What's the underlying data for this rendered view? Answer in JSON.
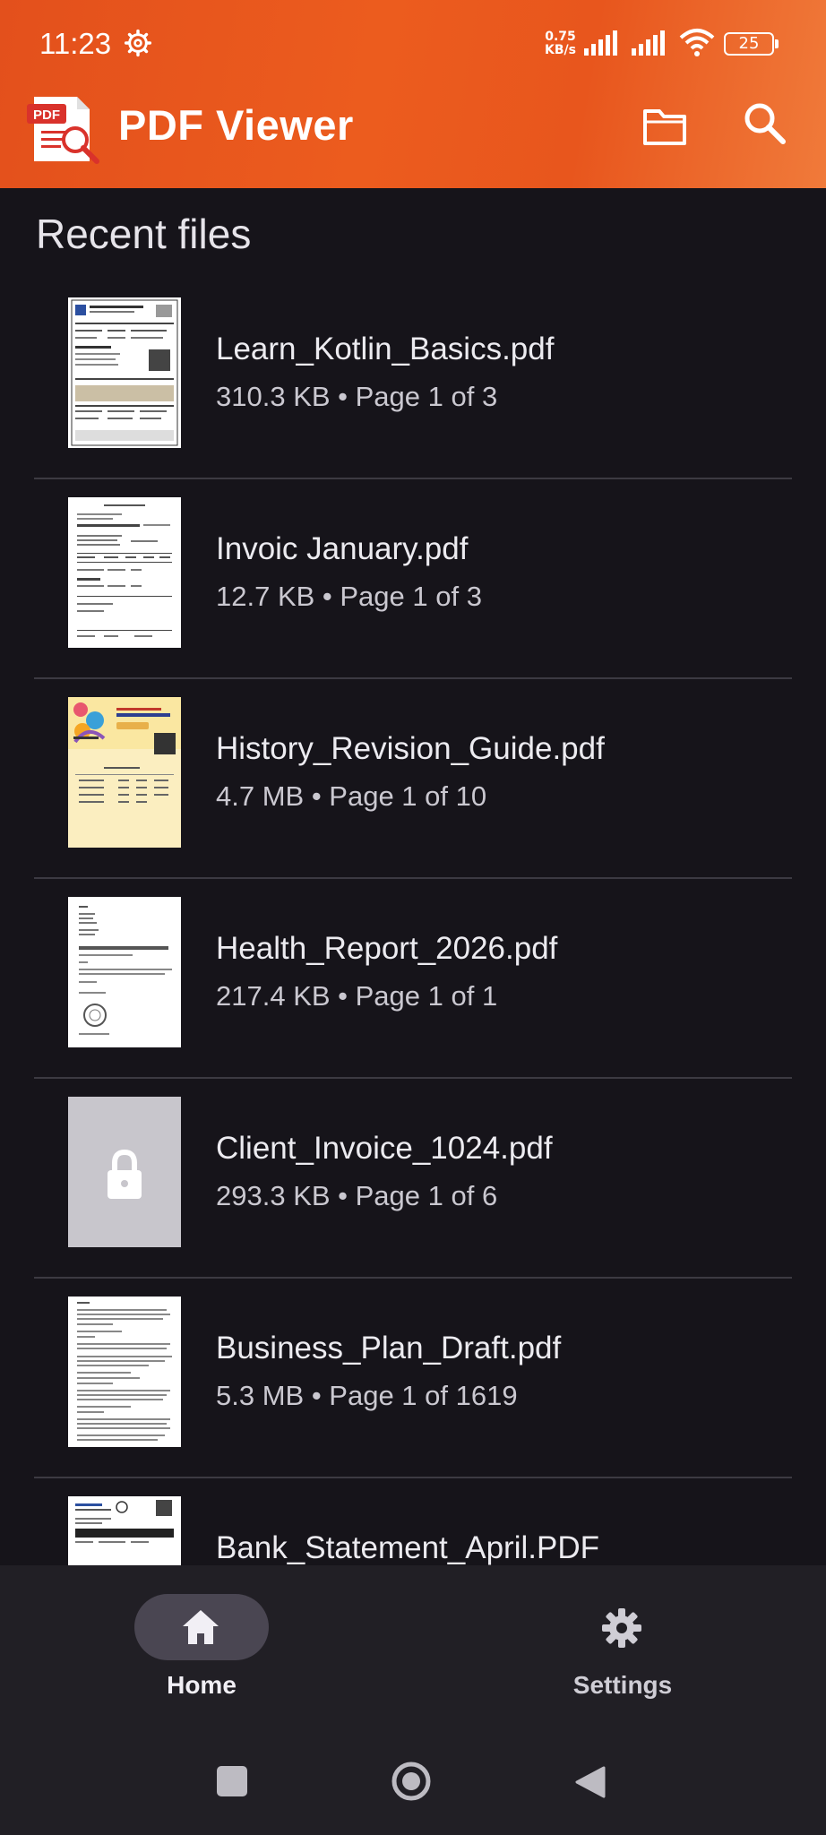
{
  "status_bar": {
    "time": "11:23",
    "net_speed_value": "0.75",
    "net_speed_unit": "KB/s",
    "battery": "25"
  },
  "app_bar": {
    "title": "PDF Viewer",
    "logo_text": "PDF"
  },
  "section_title": "Recent files",
  "files": [
    {
      "name": "Learn_Kotlin_Basics.pdf",
      "meta": "310.3 KB • Page 1 of 3",
      "thumb": "doc-form"
    },
    {
      "name": "Invoic January.pdf",
      "meta": "12.7 KB • Page 1 of 3",
      "thumb": "doc-invoice"
    },
    {
      "name": "History_Revision_Guide.pdf",
      "meta": "4.7 MB • Page 1 of 10",
      "thumb": "doc-colorful"
    },
    {
      "name": "Health_Report_2026.pdf",
      "meta": "217.4 KB • Page 1 of 1",
      "thumb": "doc-letter"
    },
    {
      "name": "Client_Invoice_1024.pdf",
      "meta": "293.3 KB • Page 1 of 6",
      "thumb": "locked"
    },
    {
      "name": "Business_Plan_Draft.pdf",
      "meta": "5.3 MB • Page 1 of 1619",
      "thumb": "doc-text"
    },
    {
      "name": "Bank_Statement_April.PDF",
      "meta": "",
      "thumb": "doc-statement"
    }
  ],
  "bottom_nav": {
    "home_label": "Home",
    "settings_label": "Settings"
  },
  "colors": {
    "header_orange": "#e8561d",
    "background": "#16141a",
    "nav_background": "#211f25"
  }
}
